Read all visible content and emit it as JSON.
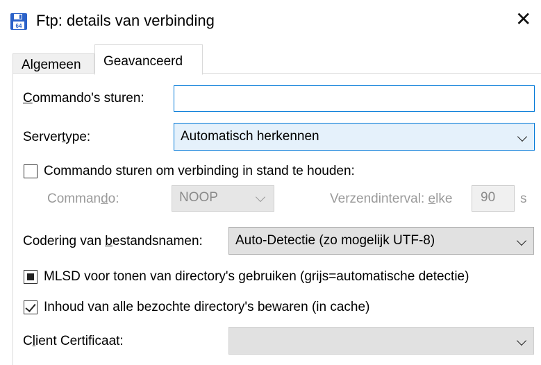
{
  "window": {
    "title": "Ftp: details van verbinding",
    "app_icon": "floppy-disk-64-icon",
    "close_glyph": "✕"
  },
  "tabs": [
    {
      "label": "Algemeen",
      "active": false
    },
    {
      "label": "Geavanceerd",
      "active": true
    }
  ],
  "commands": {
    "label_u": "C",
    "label_rest": "ommando's sturen:",
    "value": ""
  },
  "servertype": {
    "label_pre": "Server",
    "label_u": "t",
    "label_post": "ype:",
    "value": "Automatisch herkennen"
  },
  "keepalive": {
    "checked": false,
    "label": "Commando sturen om verbinding in stand te houden:",
    "command_label_pre": "Comman",
    "command_label_u": "d",
    "command_label_post": "o:",
    "command_value": "NOOP",
    "interval_label_pre": "Verzendinterval: ",
    "interval_label_u": "e",
    "interval_label_post": "lke",
    "interval_value": "90",
    "interval_unit": "s"
  },
  "encoding": {
    "label_pre": "Codering van ",
    "label_u": "b",
    "label_post": "estandsnamen:",
    "value": "Auto-Detectie (zo mogelijk UTF-8)"
  },
  "mlsd": {
    "state": "indeterminate",
    "label": "MLSD voor tonen van directory's gebruiken (grijs=automatische detectie)"
  },
  "cache": {
    "checked": true,
    "label": "Inhoud van alle bezochte directory's bewaren (in cache)"
  },
  "certificate": {
    "label_pre": "C",
    "label_u": "l",
    "label_post": "ient Certificaat:",
    "value": ""
  },
  "colors": {
    "focus_border": "#0078d7",
    "selected_bg": "#e5f1fb",
    "disabled_text": "#9a9a9a"
  }
}
